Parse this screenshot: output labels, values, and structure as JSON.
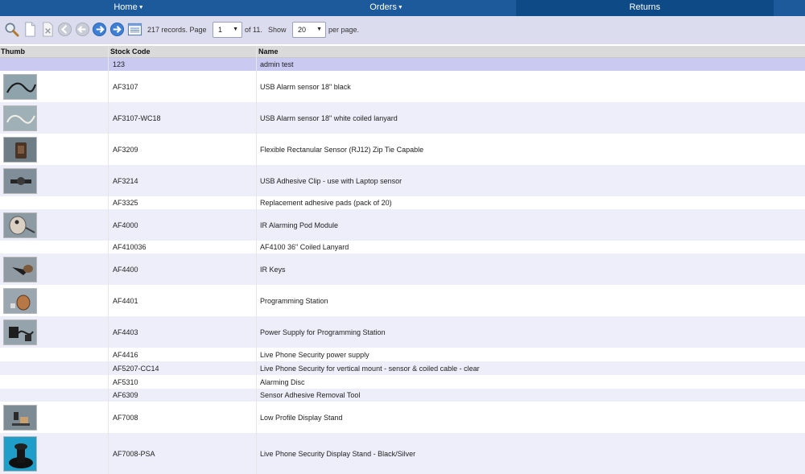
{
  "nav": {
    "home": "Home",
    "orders": "Orders",
    "returns": "Returns"
  },
  "toolbar": {
    "records_text": "217 records. Page",
    "page_value": "1",
    "of_text": "of 11.",
    "show_label": "Show",
    "show_value": "20",
    "per_page": "per page."
  },
  "table": {
    "headers": {
      "thumb": "Thumb",
      "code": "Stock Code",
      "name": "Name"
    },
    "rows": [
      {
        "code": "123",
        "name": "admin test"
      },
      {
        "code": "AF3107",
        "name": "USB Alarm sensor 18\" black"
      },
      {
        "code": "AF3107-WC18",
        "name": "USB Alarm sensor 18\" white coiled lanyard"
      },
      {
        "code": "AF3209",
        "name": "Flexible Rectanular Sensor (RJ12) Zip Tie Capable"
      },
      {
        "code": "AF3214",
        "name": "USB Adhesive Clip - use with Laptop sensor"
      },
      {
        "code": "AF3325",
        "name": "Replacement adhesive pads (pack of 20)"
      },
      {
        "code": "AF4000",
        "name": "IR Alarming Pod Module"
      },
      {
        "code": "AF410036",
        "name": "AF4100 36\" Coiled Lanyard"
      },
      {
        "code": "AF4400",
        "name": "IR Keys"
      },
      {
        "code": "AF4401",
        "name": "Programming Station"
      },
      {
        "code": "AF4403",
        "name": "Power Supply for Programming Station"
      },
      {
        "code": "AF4416",
        "name": "Live Phone Security power supply"
      },
      {
        "code": "AF5207-CC14",
        "name": "Live Phone Security for vertical mount - sensor & coiled cable - clear"
      },
      {
        "code": "AF5310",
        "name": "Alarming Disc"
      },
      {
        "code": "AF6309",
        "name": "Sensor Adhesive Removal Tool"
      },
      {
        "code": "AF7008",
        "name": "Low Profile Display Stand"
      },
      {
        "code": "AF7008-PSA",
        "name": "Live Phone Security Display Stand - Black/Silver"
      }
    ]
  }
}
